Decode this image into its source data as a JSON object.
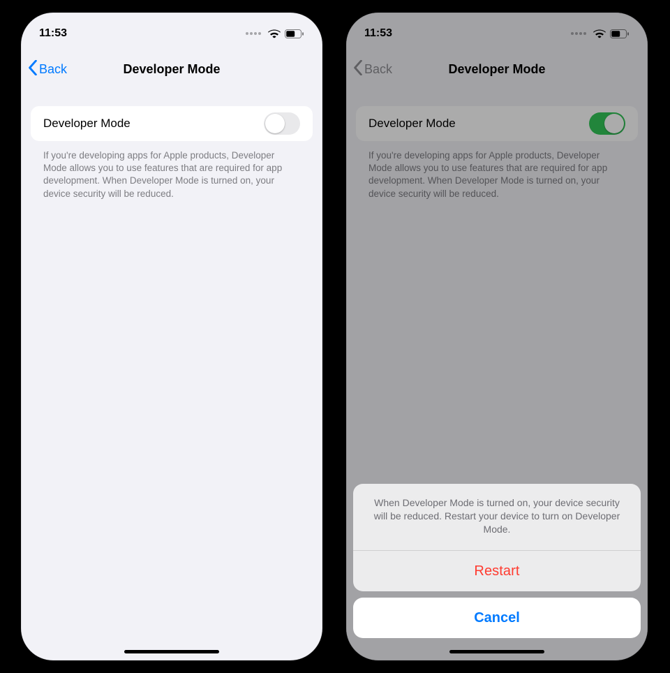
{
  "statusbar": {
    "time": "11:53"
  },
  "nav": {
    "back": "Back",
    "title": "Developer Mode"
  },
  "row": {
    "label": "Developer Mode"
  },
  "footnote": "If you're developing apps for Apple products, Developer Mode allows you to use features that are required for app development. When Developer Mode is turned on, your device security will be reduced.",
  "left": {
    "toggle_on": false
  },
  "right": {
    "toggle_on": true
  },
  "action_sheet": {
    "message": "When Developer Mode is turned on, your device security will be reduced. Restart your device to turn on Developer Mode.",
    "restart": "Restart",
    "cancel": "Cancel"
  },
  "colors": {
    "ios_blue": "#007aff",
    "ios_green": "#34c759",
    "ios_red": "#ff3b30"
  }
}
